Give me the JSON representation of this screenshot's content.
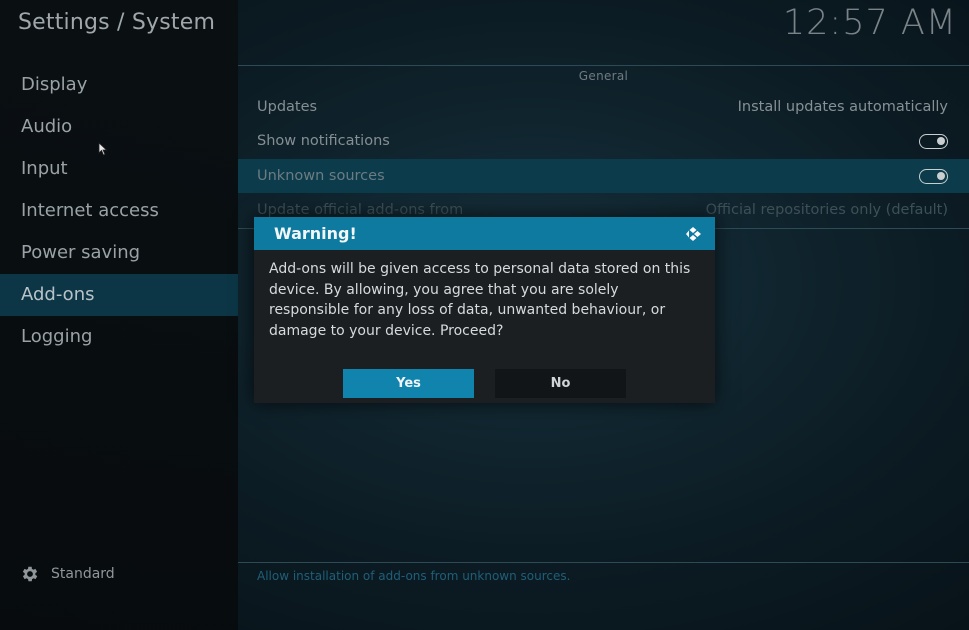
{
  "header": {
    "title": "Settings / System",
    "clock": "12:57 AM"
  },
  "sidebar": {
    "items": [
      {
        "label": "Display",
        "active": false
      },
      {
        "label": "Audio",
        "active": false
      },
      {
        "label": "Input",
        "active": false
      },
      {
        "label": "Internet access",
        "active": false
      },
      {
        "label": "Power saving",
        "active": false
      },
      {
        "label": "Add-ons",
        "active": true
      },
      {
        "label": "Logging",
        "active": false
      }
    ],
    "level_label": "Standard",
    "level_icon": "gear-icon"
  },
  "content": {
    "section_title": "General",
    "rows": [
      {
        "label": "Updates",
        "value": "Install updates automatically"
      },
      {
        "label": "Show notifications",
        "toggle": true
      },
      {
        "label": "Unknown sources",
        "toggle": true
      },
      {
        "label": "Update official add-ons from",
        "value": "Official repositories only (default)"
      }
    ],
    "help_text": "Allow installation of add-ons from unknown sources."
  },
  "dialog": {
    "title": "Warning!",
    "message": "Add-ons will be given access to personal data stored on this device. By allowing, you agree that you are solely responsible for any loss of data, unwanted behaviour, or damage to your device. Proceed?",
    "yes_label": "Yes",
    "no_label": "No",
    "logo_icon": "kodi-logo-icon"
  },
  "colors": {
    "accent": "#0e7aa0",
    "focused_row": "#0c3b4b",
    "sidebar_active": "#0c3645"
  }
}
